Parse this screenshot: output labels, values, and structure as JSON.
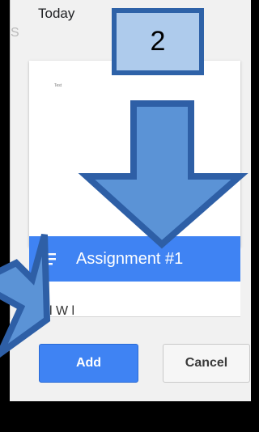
{
  "header": {
    "today_label": "Today",
    "left_peek_letter": "S"
  },
  "preview": {
    "small_text": "Test"
  },
  "assignment": {
    "title": "Assignment #1"
  },
  "list": {
    "peek_text": "l W  l"
  },
  "footer": {
    "add_label": "Add",
    "cancel_label": "Cancel"
  },
  "annotation": {
    "step_number": "2"
  },
  "colors": {
    "accent_blue": "#3f83f3",
    "annotation_fill": "#5b93d6",
    "annotation_stroke": "#2e5fa6",
    "badge_fill": "#aecbec"
  }
}
